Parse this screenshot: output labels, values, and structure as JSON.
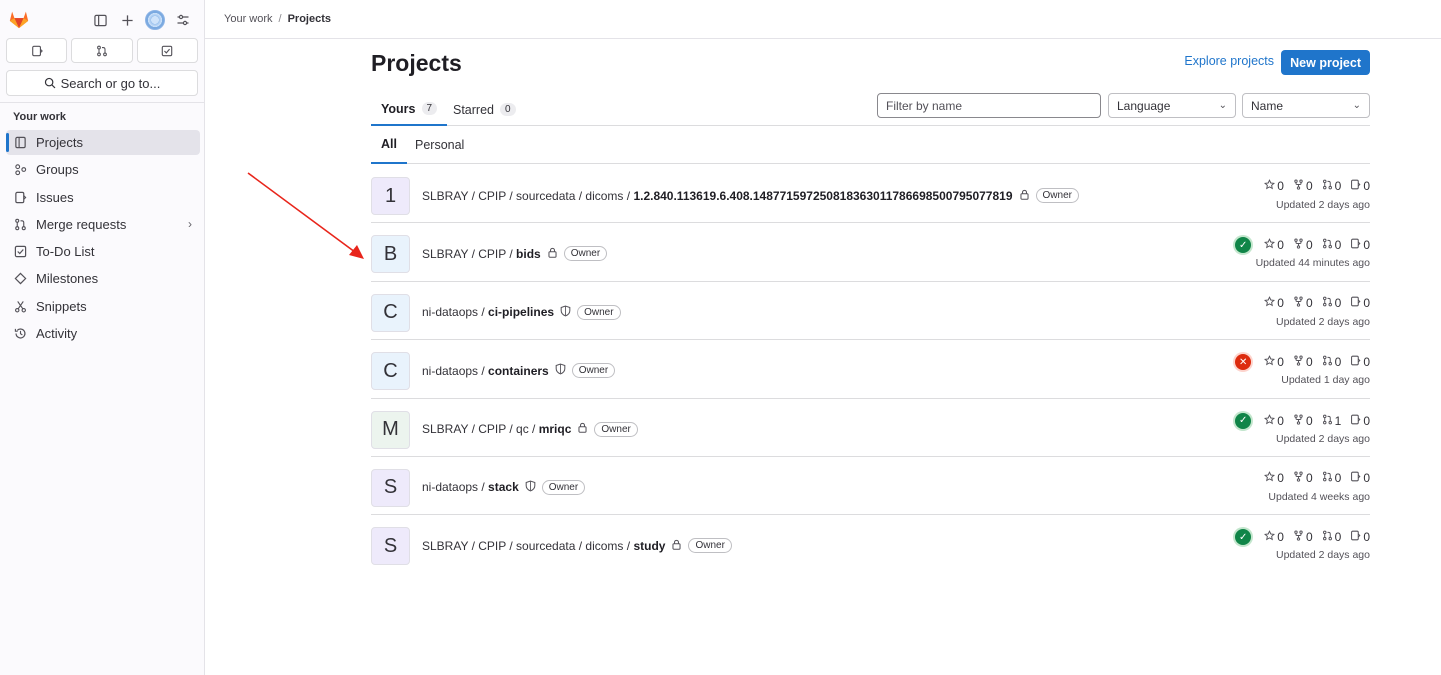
{
  "breadcrumb": {
    "parent": "Your work",
    "current": "Projects"
  },
  "sidebar": {
    "search_label": "Search or go to...",
    "section_title": "Your work",
    "items": [
      {
        "label": "Projects",
        "icon": "project-icon",
        "active": true
      },
      {
        "label": "Groups",
        "icon": "group-icon"
      },
      {
        "label": "Issues",
        "icon": "issues-icon"
      },
      {
        "label": "Merge requests",
        "icon": "merge-request-icon",
        "chevron": true
      },
      {
        "label": "To-Do List",
        "icon": "todo-icon"
      },
      {
        "label": "Milestones",
        "icon": "milestone-icon"
      },
      {
        "label": "Snippets",
        "icon": "snippet-icon"
      },
      {
        "label": "Activity",
        "icon": "history-icon"
      }
    ]
  },
  "header": {
    "title": "Projects",
    "explore_label": "Explore projects",
    "new_label": "New project"
  },
  "tabs": [
    {
      "label": "Yours",
      "count": "7",
      "active": true
    },
    {
      "label": "Starred",
      "count": "0"
    }
  ],
  "filter": {
    "placeholder": "Filter by name",
    "language": "Language",
    "sort": "Name"
  },
  "subtabs": [
    {
      "label": "All",
      "active": true
    },
    {
      "label": "Personal"
    }
  ],
  "projects": [
    {
      "letter": "1",
      "path": "SLBRAY / CPIP / sourcedata / dicoms / ",
      "leaf": "1.2.840.113619.6.408.148771597250818363011786698500795077819",
      "visibility": "private",
      "role": "Owner",
      "pipeline": "",
      "stars": "0",
      "forks": "0",
      "mrs": "0",
      "issues": "0",
      "updated": "Updated 2 days ago",
      "avatar_bg": "#eeeafb"
    },
    {
      "letter": "B",
      "path": "SLBRAY / CPIP / ",
      "leaf": "bids",
      "visibility": "private",
      "role": "Owner",
      "pipeline": "success",
      "stars": "0",
      "forks": "0",
      "mrs": "0",
      "issues": "0",
      "updated": "Updated 44 minutes ago",
      "avatar_bg": "#e9f3fc"
    },
    {
      "letter": "C",
      "path": "ni-dataops / ",
      "leaf": "ci-pipelines",
      "visibility": "internal",
      "role": "Owner",
      "pipeline": "",
      "stars": "0",
      "forks": "0",
      "mrs": "0",
      "issues": "0",
      "updated": "Updated 2 days ago",
      "avatar_bg": "#e9f3fc"
    },
    {
      "letter": "C",
      "path": "ni-dataops / ",
      "leaf": "containers",
      "visibility": "internal",
      "role": "Owner",
      "pipeline": "failed",
      "stars": "0",
      "forks": "0",
      "mrs": "0",
      "issues": "0",
      "updated": "Updated 1 day ago",
      "avatar_bg": "#e9f3fc"
    },
    {
      "letter": "M",
      "path": "SLBRAY / CPIP / qc / ",
      "leaf": "mriqc",
      "visibility": "private",
      "role": "Owner",
      "pipeline": "success",
      "stars": "0",
      "forks": "0",
      "mrs": "1",
      "issues": "0",
      "updated": "Updated 2 days ago",
      "avatar_bg": "#ecf4ee"
    },
    {
      "letter": "S",
      "path": "ni-dataops / ",
      "leaf": "stack",
      "visibility": "internal",
      "role": "Owner",
      "pipeline": "",
      "stars": "0",
      "forks": "0",
      "mrs": "0",
      "issues": "0",
      "updated": "Updated 4 weeks ago",
      "avatar_bg": "#eeeafb"
    },
    {
      "letter": "S",
      "path": "SLBRAY / CPIP / sourcedata / dicoms / ",
      "leaf": "study",
      "visibility": "private",
      "role": "Owner",
      "pipeline": "success",
      "stars": "0",
      "forks": "0",
      "mrs": "0",
      "issues": "0",
      "updated": "Updated 2 days ago",
      "avatar_bg": "#eeeafb"
    }
  ],
  "colors": {
    "accent": "#1f75cb",
    "success": "#108548",
    "failed": "#dd2b0e",
    "annotation_arrow": "#e8251b"
  }
}
